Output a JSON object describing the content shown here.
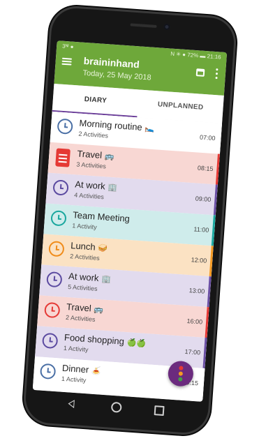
{
  "status": {
    "left": "3ᴺᴵ ●",
    "right": "N ✳ ● 72% ▬ 21:16"
  },
  "app": {
    "title": "braininhand",
    "subtitle": "Today, 25 May 2018"
  },
  "tabs": [
    {
      "label": "DIARY"
    },
    {
      "label": "UNPLANNED"
    }
  ],
  "colors": {
    "app_bar": "#6ea83a",
    "tab_indicator": "#6a3d98",
    "fab": "#6b2b7e"
  },
  "items": [
    {
      "name": "Morning routine",
      "emoji": "🛌",
      "count": "2 Activities",
      "time": "07:00",
      "bg": "#ffffff",
      "stripe": "#ffffff",
      "accent": "#4a6fa5",
      "icon": "clock-icon"
    },
    {
      "name": "Travel",
      "emoji": "🚌",
      "count": "3 Activities",
      "time": "08:15",
      "bg": "#f8d7d3",
      "stripe": "#e53935",
      "accent": "#e53935",
      "icon": "clipboard-icon"
    },
    {
      "name": "At work",
      "emoji": "🏢",
      "count": "4 Activities",
      "time": "09:00",
      "bg": "#e2dbee",
      "stripe": "#6a4fa3",
      "accent": "#5b4aa0",
      "icon": "clock-icon"
    },
    {
      "name": "Team Meeting",
      "emoji": "",
      "count": "1 Activity",
      "time": "11:00",
      "bg": "#cfeceb",
      "stripe": "#1aa79e",
      "accent": "#1aa79e",
      "icon": "clock-icon"
    },
    {
      "name": "Lunch",
      "emoji": "🥪",
      "count": "2 Activities",
      "time": "12:00",
      "bg": "#fbe2c3",
      "stripe": "#f59a23",
      "accent": "#f08c1a",
      "icon": "clock-icon"
    },
    {
      "name": "At work",
      "emoji": "🏢",
      "count": "5 Activities",
      "time": "13:00",
      "bg": "#e2dbee",
      "stripe": "#6a4fa3",
      "accent": "#5b4aa0",
      "icon": "clock-icon"
    },
    {
      "name": "Travel",
      "emoji": "🚌",
      "count": "2 Activities",
      "time": "16:00",
      "bg": "#f8d7d3",
      "stripe": "#e53935",
      "accent": "#e53935",
      "icon": "clock-icon"
    },
    {
      "name": "Food shopping",
      "emoji": "🍏🍏",
      "count": "1 Activity",
      "time": "17:00",
      "bg": "#e2dbee",
      "stripe": "#6a4fa3",
      "accent": "#5b4aa0",
      "icon": "clock-icon"
    },
    {
      "name": "Dinner",
      "emoji": "🍝",
      "count": "1 Activity",
      "time": "19:15",
      "bg": "#ffffff",
      "stripe": "#ffffff",
      "accent": "#4a6fa5",
      "icon": "clock-icon"
    }
  ],
  "icons": {
    "menu": "hamburger-menu-icon",
    "calendar": "calendar-icon",
    "more": "more-vert-icon",
    "fab": "traffic-light-icon",
    "nav": [
      "back-icon",
      "home-icon",
      "recents-icon"
    ]
  }
}
